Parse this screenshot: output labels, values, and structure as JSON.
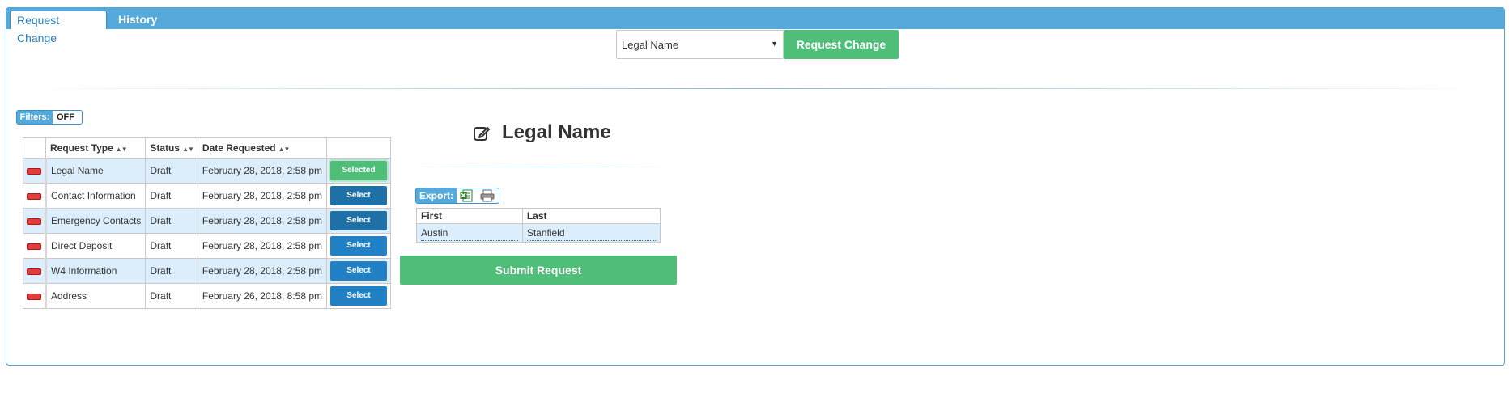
{
  "tabs": {
    "active": "Request Change",
    "inactive": "History"
  },
  "request_form": {
    "selected_type": "Legal Name",
    "button_label": "Request Change"
  },
  "filters": {
    "label": "Filters:",
    "state": "OFF"
  },
  "requests_table": {
    "headers": {
      "type": "Request Type",
      "status": "Status",
      "date": "Date Requested"
    },
    "rows": [
      {
        "type": "Legal Name",
        "status": "Draft",
        "date": "February 28, 2018, 2:58 pm",
        "action": "Selected"
      },
      {
        "type": "Contact Information",
        "status": "Draft",
        "date": "February 28, 2018, 2:58 pm",
        "action": "Select"
      },
      {
        "type": "Emergency Contacts",
        "status": "Draft",
        "date": "February 28, 2018, 2:58 pm",
        "action": "Select"
      },
      {
        "type": "Direct Deposit",
        "status": "Draft",
        "date": "February 28, 2018, 2:58 pm",
        "action": "Select"
      },
      {
        "type": "W4 Information",
        "status": "Draft",
        "date": "February 28, 2018, 2:58 pm",
        "action": "Select"
      },
      {
        "type": "Address",
        "status": "Draft",
        "date": "February 26, 2018, 8:58 pm",
        "action": "Select"
      }
    ]
  },
  "detail": {
    "title": "Legal Name",
    "export_label": "Export:",
    "columns": {
      "first": "First",
      "last": "Last"
    },
    "values": {
      "first": "Austin",
      "last": "Stanfield"
    },
    "submit_label": "Submit Request"
  },
  "colors": {
    "tab_bar": "#55a9db",
    "accent_green": "#4fbe79",
    "select_blue": "#2281c4",
    "row_highlight": "#dcedfb",
    "remove_red": "#e53a3a"
  },
  "icons": {
    "edit": "edit-icon",
    "excel": "excel-icon",
    "print": "print-icon",
    "remove": "remove-icon",
    "sort": "sort-icon",
    "dropdown": "chevron-down-icon"
  }
}
